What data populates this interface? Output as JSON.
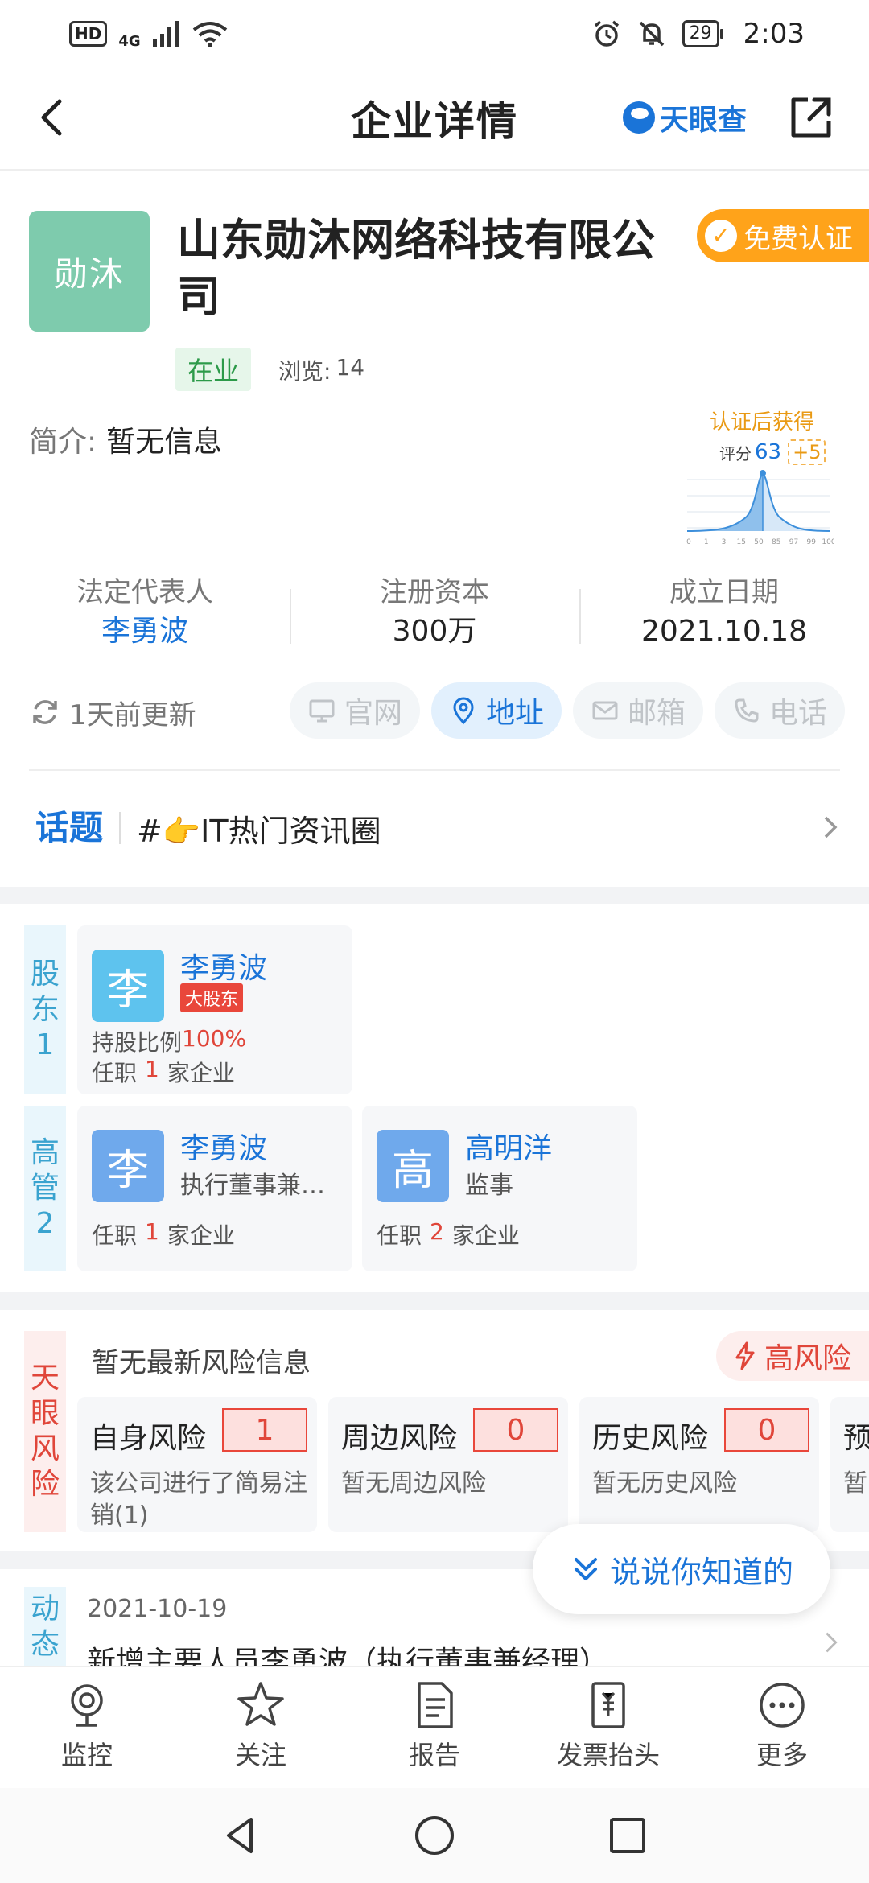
{
  "status_bar": {
    "network_badge": "HD",
    "network_type": "4G",
    "battery": "29",
    "time": "2:03"
  },
  "nav": {
    "title": "企业详情",
    "brand": "天眼查"
  },
  "company": {
    "logo_text": "勋沐",
    "name": "山东勋沐网络科技有限公司",
    "verify_label": "免费认证",
    "status": "在业",
    "views_label": "浏览:",
    "views_count": "14",
    "intro_label": "简介:",
    "intro_value": "暂无信息"
  },
  "score_card": {
    "title": "认证后获得",
    "score_label": "评分",
    "score": "63",
    "bonus": "+5",
    "axis_ticks": [
      "0",
      "1",
      "3",
      "15",
      "50",
      "85",
      "97",
      "99",
      "100"
    ]
  },
  "stats": [
    {
      "label": "法定代表人",
      "value": "李勇波"
    },
    {
      "label": "注册资本",
      "value": "300万"
    },
    {
      "label": "成立日期",
      "value": "2021.10.18"
    }
  ],
  "update": {
    "text": "1天前更新"
  },
  "contacts": [
    {
      "label": "官网",
      "active": false
    },
    {
      "label": "地址",
      "active": true
    },
    {
      "label": "邮箱",
      "active": false
    },
    {
      "label": "电话",
      "active": false
    }
  ],
  "topic": {
    "label": "话题",
    "text": "#👉IT热门资讯圈"
  },
  "shareholders": {
    "side": [
      "股",
      "东",
      "1"
    ],
    "people": [
      {
        "avatar": "李",
        "name": "李勇波",
        "badge": "大股东",
        "ratio_label": "持股比例",
        "ratio": "100%",
        "jobs_prefix": "任职",
        "jobs": "1",
        "jobs_suffix": "家企业"
      }
    ]
  },
  "management": {
    "side": [
      "高",
      "管",
      "2"
    ],
    "people": [
      {
        "avatar": "李",
        "name": "李勇波",
        "role": "执行董事兼经理",
        "role_display": "执行董事兼…",
        "jobs_prefix": "任职",
        "jobs": "1",
        "jobs_suffix": "家企业"
      },
      {
        "avatar": "高",
        "name": "高明洋",
        "role": "监事",
        "role_display": "监事",
        "jobs_prefix": "任职",
        "jobs": "2",
        "jobs_suffix": "家企业"
      }
    ]
  },
  "risk": {
    "side": [
      "天",
      "眼",
      "风",
      "险"
    ],
    "heading": "暂无最新风险信息",
    "level": "高风险",
    "cards": [
      {
        "title": "自身风险",
        "count": "1",
        "desc": "该公司进行了简易注销(1)"
      },
      {
        "title": "周边风险",
        "count": "0",
        "desc": "暂无周边风险"
      },
      {
        "title": "历史风险",
        "count": "0",
        "desc": "暂无历史风险"
      },
      {
        "title": "预",
        "count": "",
        "desc": "暂"
      }
    ]
  },
  "dynamics": {
    "side": [
      "动",
      "态"
    ],
    "date": "2021-10-19",
    "text": "新增主要人员李勇波（执行董事兼经理）"
  },
  "float_button": {
    "label": "说说你知道的"
  },
  "actions": [
    {
      "label": "监控",
      "icon": "monitor-camera-icon"
    },
    {
      "label": "关注",
      "icon": "star-icon"
    },
    {
      "label": "报告",
      "icon": "report-document-icon"
    },
    {
      "label": "发票抬头",
      "icon": "invoice-icon"
    },
    {
      "label": "更多",
      "icon": "more-dots-icon"
    }
  ],
  "colors": {
    "brand_blue": "#1a74d8",
    "logo_green": "#7ecbad",
    "verify_orange": "#ffa31a",
    "risk_red": "#e0463a",
    "status_green": "#2c9a49"
  }
}
